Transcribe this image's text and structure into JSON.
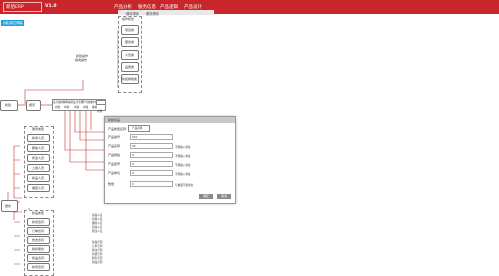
{
  "header": {
    "brand": "新佰ERP",
    "version": "V1.0",
    "nav": [
      "产品分析",
      "服务信息",
      "产品逻辑",
      "产品设计"
    ],
    "sub": [
      "横向排版",
      "服务规则"
    ]
  },
  "side_button": "功能/新拉横幅",
  "top_group": {
    "title": "操作新建",
    "items": [
      "项目类",
      "服务类",
      "人员类",
      "品质类",
      "新拓横幅类"
    ]
  },
  "annotation": [
    "新建操作",
    "横向操作"
  ],
  "nodes": {
    "left": "新建",
    "mid": "概览"
  },
  "table": {
    "header": [
      "设计编码",
      "物料编码",
      "设计名称",
      "型号规格",
      "单位"
    ],
    "row": [
      "内容",
      "内容",
      "内容",
      "内容",
      "编辑"
    ],
    "extra": "内容"
  },
  "bottom_node": "服务",
  "group_a": {
    "title": "服务类型",
    "items": [
      "新增人员",
      "删除人员",
      "修改人员",
      "上报人员",
      "新品人员",
      "撤回人员"
    ]
  },
  "group_b": {
    "title": "新品类型",
    "items": [
      "新增合同",
      "订单合同",
      "修改合同",
      "税务服务",
      "新品合同",
      "新增合同"
    ]
  },
  "list_a": [
    "新品人员",
    "新增人员",
    "删除人员",
    "新品人员",
    "修改人员"
  ],
  "list_b": [
    "新品合同",
    "订单合同",
    "修改合同",
    "新增合同",
    "税务合同",
    "新品合同"
  ],
  "dialog": {
    "title": "新建标品",
    "product_type_label": "产品类型名称",
    "product_type_btn": "产品名称",
    "fields": [
      {
        "label": "产品编号",
        "value": "001",
        "hint": ""
      },
      {
        "label": "产品名称",
        "value": "SP",
        "hint": "不能输入重复"
      },
      {
        "label": "产品规格",
        "value": "0",
        "hint": "不能输入重复"
      },
      {
        "label": "产品型号",
        "value": "0",
        "hint": "不能输入重复"
      },
      {
        "label": "产品单位",
        "value": "0",
        "hint": "不能输入重复"
      },
      {
        "label": "数量",
        "value": "0",
        "hint": "与数量不要重复"
      }
    ],
    "ok": "确定",
    "cancel": "取消"
  }
}
